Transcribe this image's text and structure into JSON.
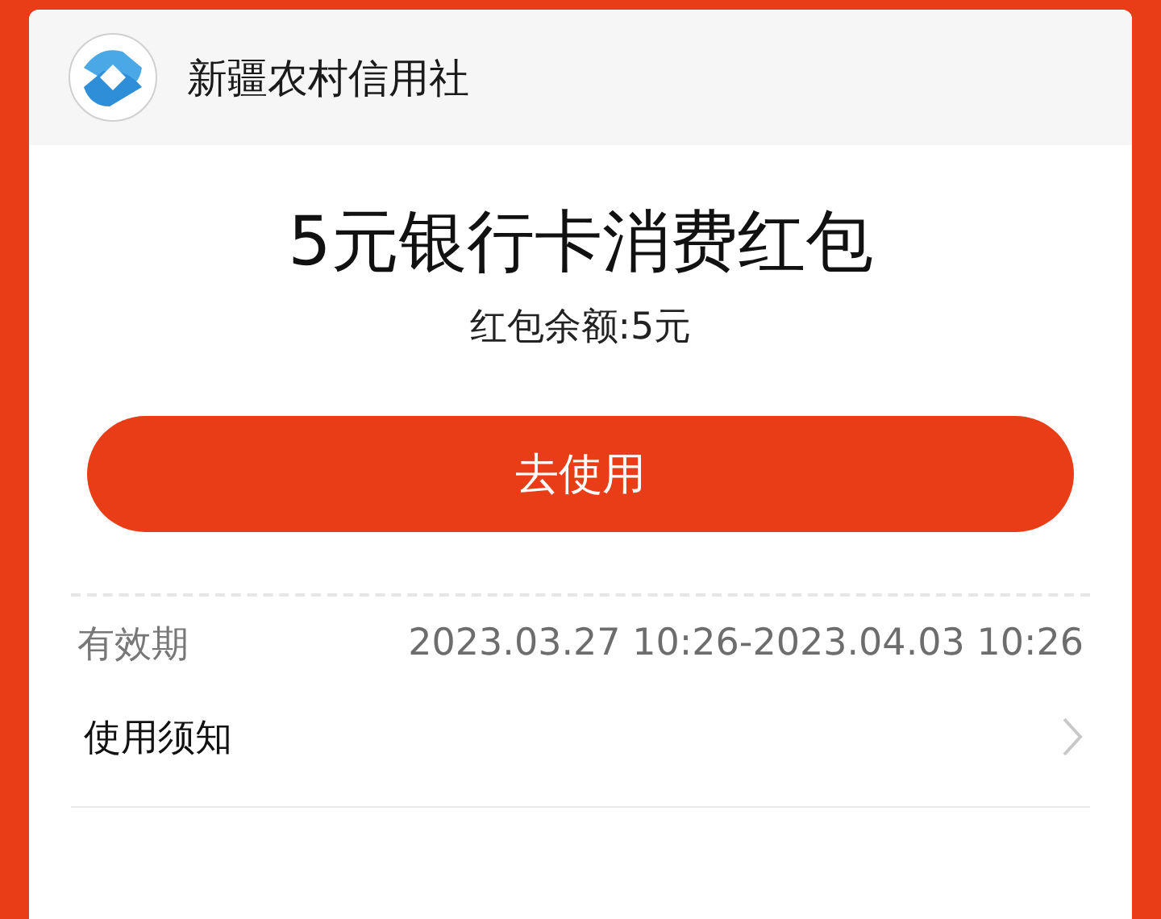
{
  "header": {
    "bank_name": "新疆农村信用社"
  },
  "coupon": {
    "title": "5元银行卡消费红包",
    "balance": "红包余额:5元"
  },
  "use_button": "去使用",
  "details": [
    {
      "kind": "info",
      "label": "有效期",
      "value": "2023.03.27 10:26-2023.04.03 10:26"
    },
    {
      "kind": "link",
      "label": "使用须知"
    }
  ]
}
